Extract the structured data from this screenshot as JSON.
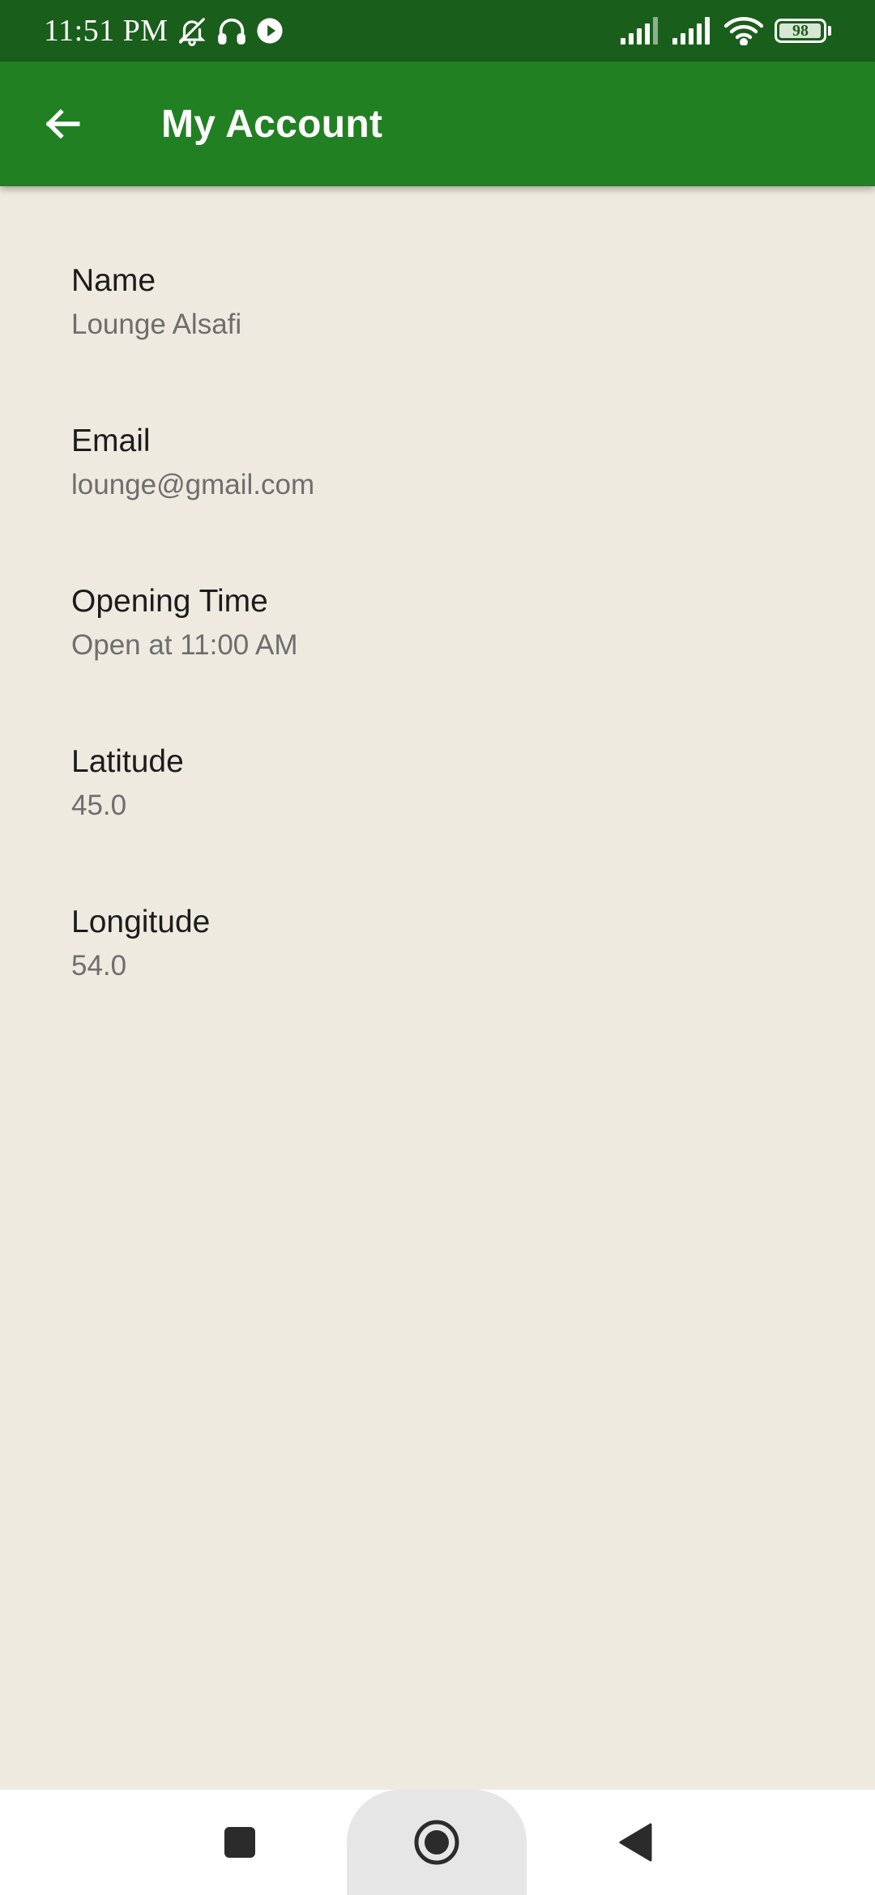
{
  "status_bar": {
    "time": "11:51 PM",
    "battery_level": "98",
    "icons": [
      "bell-off-icon",
      "headphones-icon",
      "play-circle-icon",
      "signal-icon",
      "signal-icon",
      "wifi-icon",
      "battery-icon"
    ]
  },
  "app_bar": {
    "title": "My Account",
    "back_icon": "arrow-left-icon"
  },
  "fields": [
    {
      "label": "Name",
      "value": "Lounge Alsafi"
    },
    {
      "label": "Email",
      "value": "lounge@gmail.com"
    },
    {
      "label": "Opening Time",
      "value": "Open at 11:00 AM"
    },
    {
      "label": "Latitude",
      "value": "45.0"
    },
    {
      "label": "Longitude",
      "value": "54.0"
    }
  ],
  "nav_bar": {
    "buttons": [
      "recents-icon",
      "home-icon",
      "back-triangle-icon"
    ]
  },
  "colors": {
    "status_bar": "#1a5e1c",
    "app_bar": "#218022",
    "background": "#eeeae0",
    "label_text": "#1c1c1c",
    "value_text": "#6e6e6e"
  }
}
